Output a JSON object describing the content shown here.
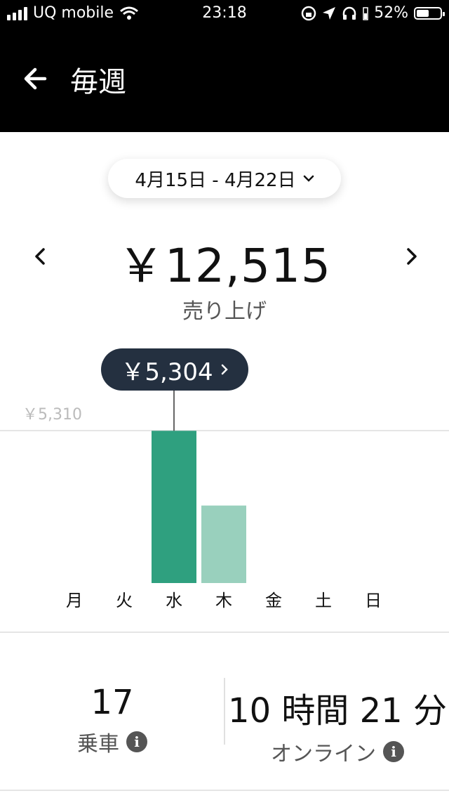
{
  "status_bar": {
    "carrier": "UQ mobile",
    "time": "23:18",
    "battery": "52%",
    "battery_level": 0.52
  },
  "header": {
    "title": "毎週"
  },
  "date_range": {
    "label": "4月15日 - 4月22日"
  },
  "earnings": {
    "total": "￥12,515",
    "label": "売り上げ"
  },
  "tooltip": {
    "value": "￥5,304"
  },
  "chart_data": {
    "type": "bar",
    "categories": [
      "月",
      "火",
      "水",
      "木",
      "金",
      "土",
      "日"
    ],
    "values": [
      0,
      0,
      5304,
      2700,
      0,
      0,
      0
    ],
    "selected_index": 2,
    "ymax_label": "￥5,310",
    "ylim": [
      0,
      5310
    ],
    "colors": {
      "selected": "#2fa07f",
      "default": "#99d0bd"
    }
  },
  "stats": {
    "trips": {
      "value": "17",
      "label": "乗車"
    },
    "online": {
      "value": "10 時間 21 分",
      "label": "オンライン"
    }
  }
}
